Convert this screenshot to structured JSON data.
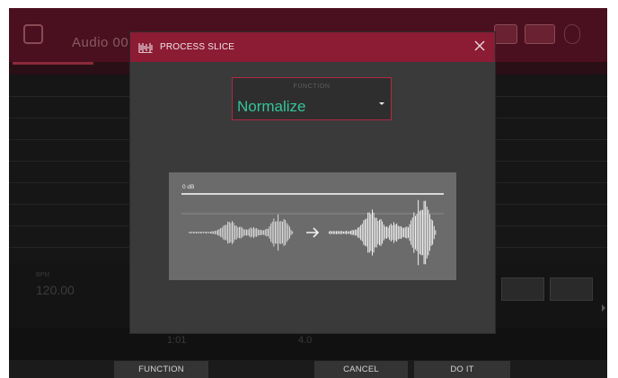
{
  "background": {
    "app_title": "Audio 00",
    "tempo_label": "BPM",
    "tempo_value": "120.00",
    "bottom_cells": [
      "1:01",
      "4.0"
    ]
  },
  "dialog": {
    "icon": "waveform-icon",
    "title": "PROCESS SLICE",
    "close_icon": "close-icon",
    "function_label": "FUNCTION",
    "function_value": "Normalize",
    "dropdown_icon": "chevron-down-icon",
    "preview": {
      "level_label": "0 dB",
      "arrow_icon": "right-arrow-icon"
    }
  },
  "softkeys": {
    "function": "FUNCTION",
    "cancel": "CANCEL",
    "do_it": "DO IT"
  },
  "colors": {
    "accent": "#8c1b34",
    "function_value": "#35c49a",
    "dialog_bg": "#3a3a3a",
    "preview_bg": "#6b6b6b"
  }
}
